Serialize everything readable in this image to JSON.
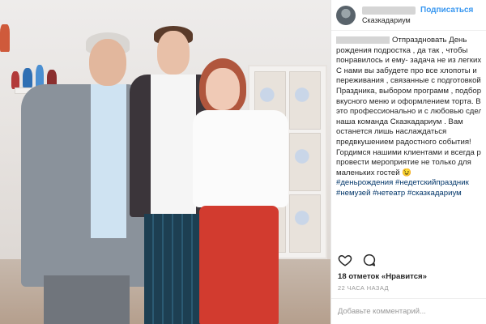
{
  "post": {
    "header": {
      "follow_label": "Подписаться",
      "location": "Сказкадариум"
    },
    "caption": {
      "lines": [
        "Отпраздновать День",
        "рождения подростка , да так , чтобы",
        "понравилось и ему- задача не из легких!",
        "С нами вы забудете про все хлопоты и",
        "переживания , связанные с подготовкой",
        "Праздника, выбором программ , подбор",
        "вкусного меню и оформлением торта. В",
        "это профессионально и с любовью сдел",
        "наша команда Сказкадариум . Вам",
        "останется лишь наслаждаться",
        "предвкушением радостного события!",
        "Гордимся нашими клиентами и всегда р",
        "провести мероприятие не только для",
        "маленьких гостей 😉"
      ],
      "hashtags": [
        "#деньрождения #недетскийпраздник",
        "#немузей #нетеатр #сказкадариум"
      ]
    },
    "icons": {
      "like": "heart-icon",
      "comment": "comment-icon",
      "accent": "#3897f0"
    },
    "likes_text": "18 отметок «Нравится»",
    "time_text": "22 ЧАСА НАЗАД",
    "comment_placeholder": "Добавьте комментарий..."
  }
}
